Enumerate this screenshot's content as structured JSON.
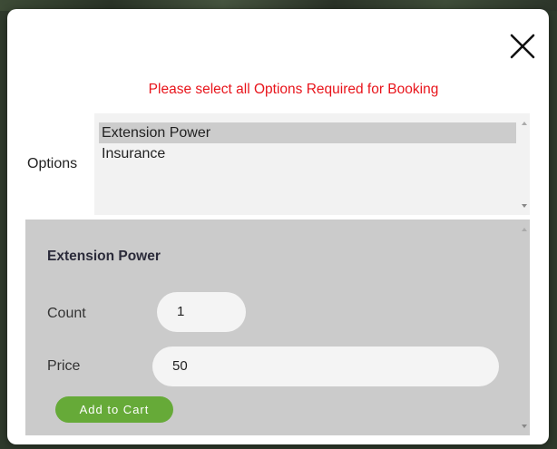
{
  "modal": {
    "close_icon": "close-icon",
    "notice": "Please select all Options Required for Booking",
    "notice_color": "#e8141b"
  },
  "options": {
    "label": "Options",
    "items": [
      {
        "label": "Extension Power",
        "selected": true
      },
      {
        "label": "Insurance",
        "selected": false
      }
    ]
  },
  "detail": {
    "title": "Extension Power",
    "count_label": "Count",
    "count_value": "1",
    "price_label": "Price",
    "price_value": "50",
    "add_button_label": "Add to Cart",
    "add_button_color": "#66aa38"
  }
}
